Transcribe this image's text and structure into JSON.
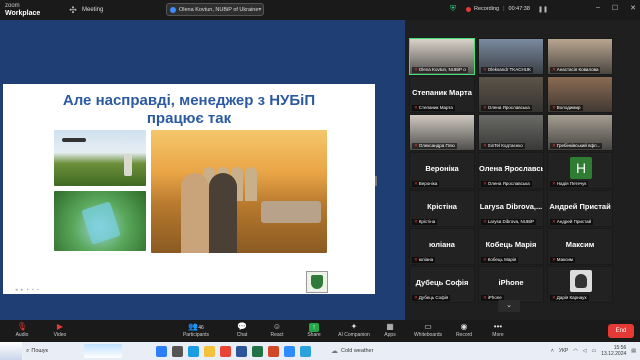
{
  "app": {
    "brand_line1": "zoom",
    "brand_line2": "Workplace",
    "meeting_label": "Meeting",
    "share_label": "Olena Kovtun, NUBiP of Ukraine",
    "recording_label": "Recording",
    "timer": "00:47:38"
  },
  "slide": {
    "title_line1": "Але насправді, менеджер з НУБіП",
    "title_line2": "працює так"
  },
  "gallery": {
    "tiles": [
      {
        "label": "Olena Kovtun, NUBiP o",
        "video": true,
        "active": true,
        "bg": "#d9d2c8"
      },
      {
        "label": "Oleksandr TKACHUK",
        "video": true,
        "bg": "#7a8aa0"
      },
      {
        "label": "Анастасія Ковалова",
        "video": true,
        "bg": "#b9a690"
      },
      {
        "label": "Степаник Марта",
        "big": "Степаник Марта",
        "video": false
      },
      {
        "label": "Олена Ярославська",
        "video": true,
        "bg": "#5c5448"
      },
      {
        "label": "Володимир",
        "video": true,
        "bg": "#8a6a52"
      },
      {
        "label": "Олександра Плю",
        "video": true,
        "bg": "#cfc9c0"
      },
      {
        "label": "SinTel Кодтаєнко",
        "video": true,
        "bg": "#6a6a66"
      },
      {
        "label": "Гребінківський вфп...",
        "video": true,
        "bg": "#a59e92"
      },
      {
        "label": "Вероніка",
        "big": "Вероніка",
        "video": false
      },
      {
        "label": "Олена Ярославська",
        "big": "Олена Ярославська",
        "video": false
      },
      {
        "label": "Надія Петечук",
        "avatar": "H",
        "video": false
      },
      {
        "label": "Крістіна",
        "big": "Крістіна",
        "video": false
      },
      {
        "label": "Larysa Dibrova, NUBiP",
        "big": "Larysa Dibrova,...",
        "video": false
      },
      {
        "label": "Андрей Пристай",
        "big": "Андрей Пристай",
        "video": false
      },
      {
        "label": "юліана",
        "big": "юліана",
        "video": false
      },
      {
        "label": "Кобець Марія",
        "big": "Кобець Марія",
        "video": false
      },
      {
        "label": "Максим",
        "big": "Максим",
        "video": false
      },
      {
        "label": "Дубець Софія",
        "big": "Дубець Софія",
        "video": false
      },
      {
        "label": "iPhone",
        "big": "iPhone",
        "video": false
      },
      {
        "label": "Дарія Карнаух",
        "photo": true,
        "video": false
      }
    ]
  },
  "toolbar": {
    "audio": "Audio",
    "video": "Video",
    "participants": "Participants",
    "participants_count": "46",
    "chat": "Chat",
    "react": "React",
    "share": "Share",
    "ai_companion": "AI Companion",
    "apps": "Apps",
    "whiteboards": "Whiteboards",
    "record": "Record",
    "more": "More",
    "end": "End"
  },
  "taskbar": {
    "search": "Пошук",
    "weather": "Cold weather",
    "lang": "УКР",
    "time": "15:56",
    "date": "13.12.2024"
  }
}
